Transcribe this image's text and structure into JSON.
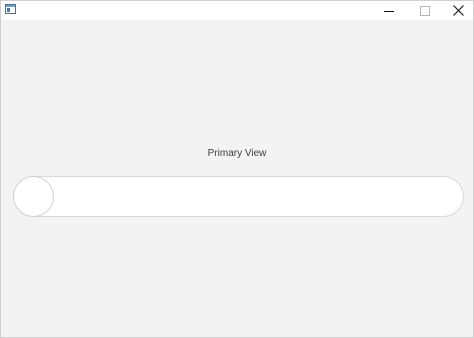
{
  "window": {
    "title": "",
    "app_icon": "window-app-icon",
    "controls": {
      "minimize_icon": "minimize-icon",
      "maximize_icon": "maximize-icon",
      "close_icon": "close-icon"
    }
  },
  "main": {
    "view_label": "Primary View",
    "toggle": {
      "state": "off",
      "value": 0
    }
  },
  "colors": {
    "background": "#f3f3f3",
    "titlebar": "#ffffff",
    "track": "#ffffff",
    "track_border": "#d8d8d8"
  }
}
